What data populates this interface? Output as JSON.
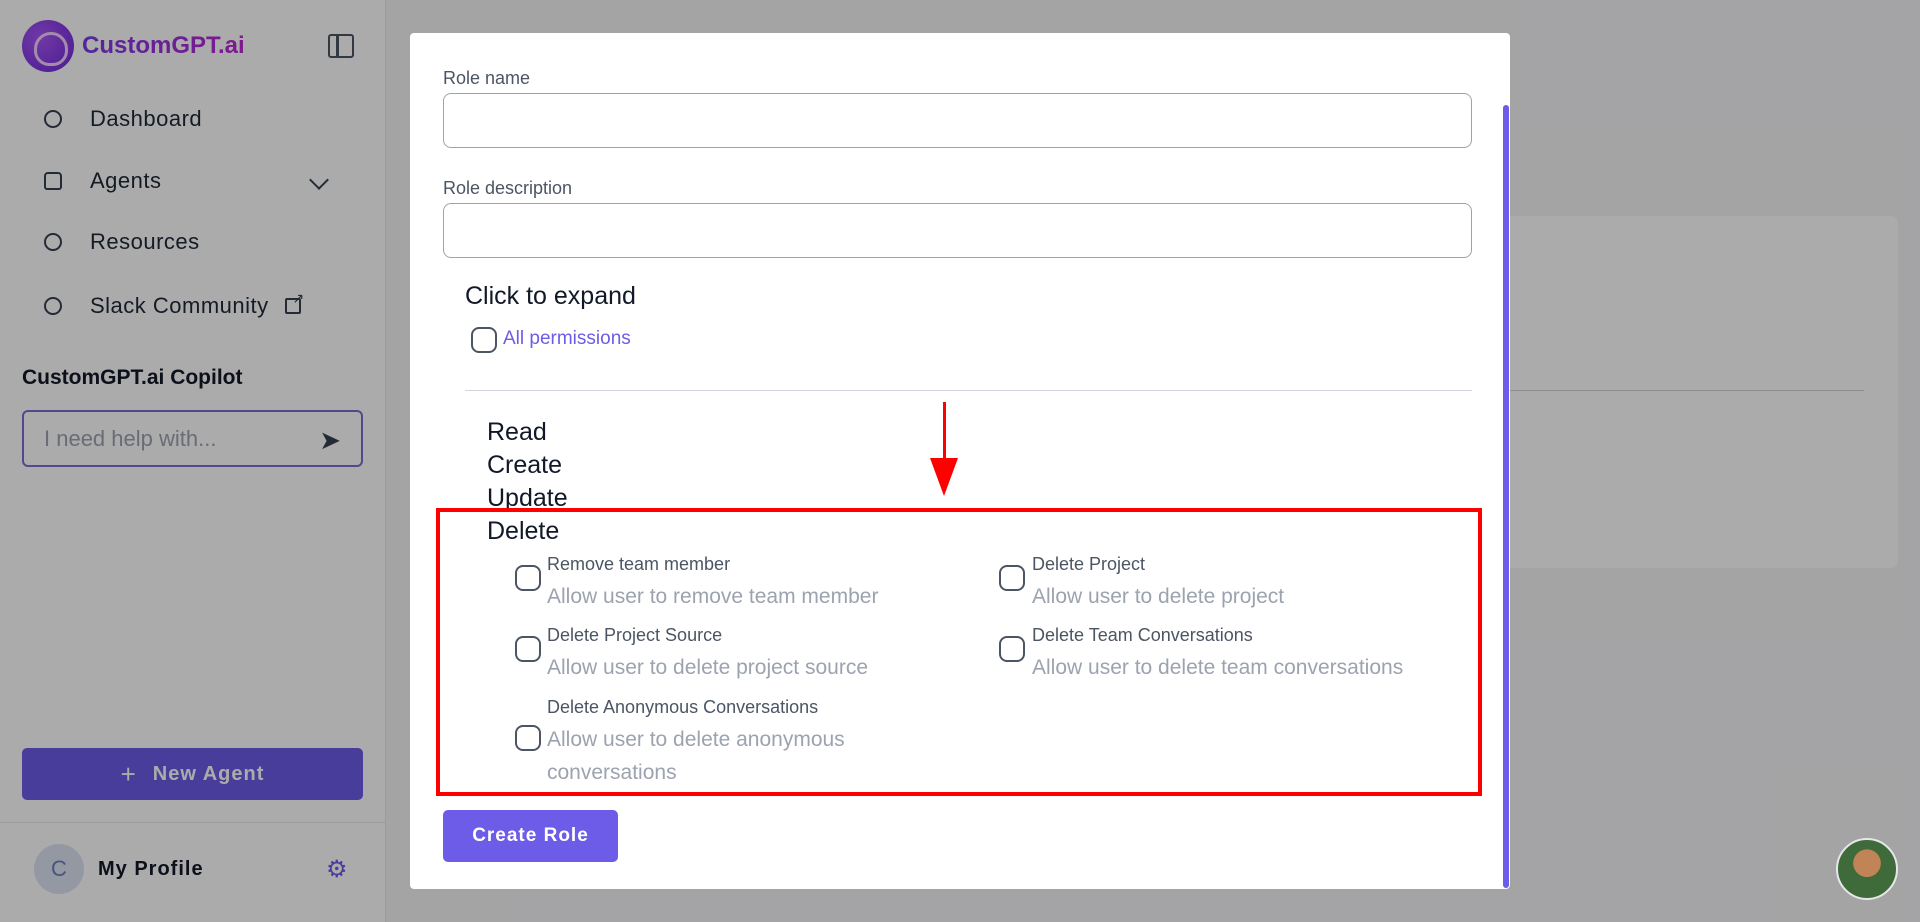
{
  "sidebar": {
    "brand": "CustomGPT.ai",
    "nav": [
      {
        "label": "Dashboard",
        "icon": "dashboard-icon"
      },
      {
        "label": "Agents",
        "icon": "home-icon"
      },
      {
        "label": "Resources",
        "icon": "lifebuoy-icon"
      },
      {
        "label": "Slack Community",
        "icon": "slack-icon"
      }
    ],
    "copilot_title": "CustomGPT.ai Copilot",
    "copilot_placeholder": "I need help with...",
    "new_agent_label": "New Agent",
    "profile_initial": "C",
    "profile_name": "My Profile"
  },
  "modal": {
    "role_name_label": "Role name",
    "role_name_value": "",
    "role_description_label": "Role description",
    "role_description_value": "",
    "expand_title": "Click to expand",
    "all_permissions_label": "All permissions",
    "crud_headings": [
      "Read",
      "Create",
      "Update",
      "Delete"
    ],
    "permissions": [
      {
        "title": "Remove team member",
        "desc": "Allow user to remove team member"
      },
      {
        "title": "Delete Project",
        "desc": "Allow user to delete project"
      },
      {
        "title": "Delete Project Source",
        "desc": "Allow user to delete project source"
      },
      {
        "title": "Delete Team Conversations",
        "desc": "Allow user to delete team conversations"
      },
      {
        "title": "Delete Anonymous Conversations",
        "desc": "Allow user to delete anonymous conversations"
      }
    ],
    "submit_label": "Create Role"
  },
  "colors": {
    "accent": "#6d5ce7",
    "highlight": "#ff0000"
  }
}
